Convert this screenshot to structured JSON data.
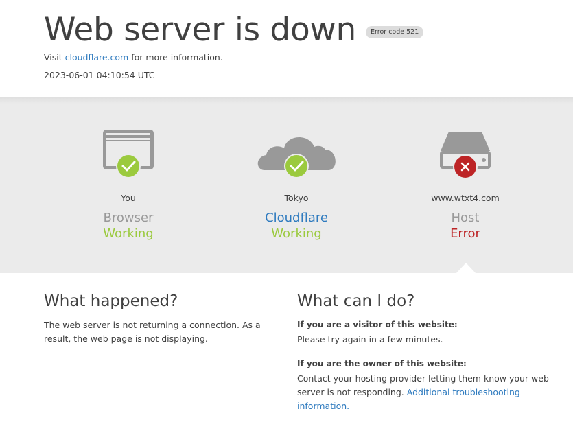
{
  "header": {
    "title": "Web server is down",
    "error_code": "Error code 521",
    "visit_prefix": "Visit ",
    "visit_link": "cloudflare.com",
    "visit_suffix": " for more information.",
    "timestamp": "2023-06-01 04:10:54 UTC"
  },
  "status": {
    "browser": {
      "location": "You",
      "name": "Browser",
      "status": "Working",
      "icon": "browser-icon",
      "indicator": "check-icon"
    },
    "cloudflare": {
      "location": "Tokyo",
      "name": "Cloudflare",
      "status": "Working",
      "icon": "cloud-icon",
      "indicator": "check-icon"
    },
    "host": {
      "location": "www.wtxt4.com",
      "name": "Host",
      "status": "Error",
      "icon": "server-icon",
      "indicator": "error-x-icon"
    }
  },
  "what_happened": {
    "heading": "What happened?",
    "body": "The web server is not returning a connection. As a result, the web page is not displaying."
  },
  "what_can_i_do": {
    "heading": "What can I do?",
    "visitor_heading": "If you are a visitor of this website:",
    "visitor_body": "Please try again in a few minutes.",
    "owner_heading": "If you are the owner of this website:",
    "owner_body": "Contact your hosting provider letting them know your web server is not responding. ",
    "owner_link": "Additional troubleshooting information."
  },
  "colors": {
    "ok": "#9bca3e",
    "error": "#bd2426",
    "link": "#2f7bbf",
    "icon_gray": "#999999"
  }
}
